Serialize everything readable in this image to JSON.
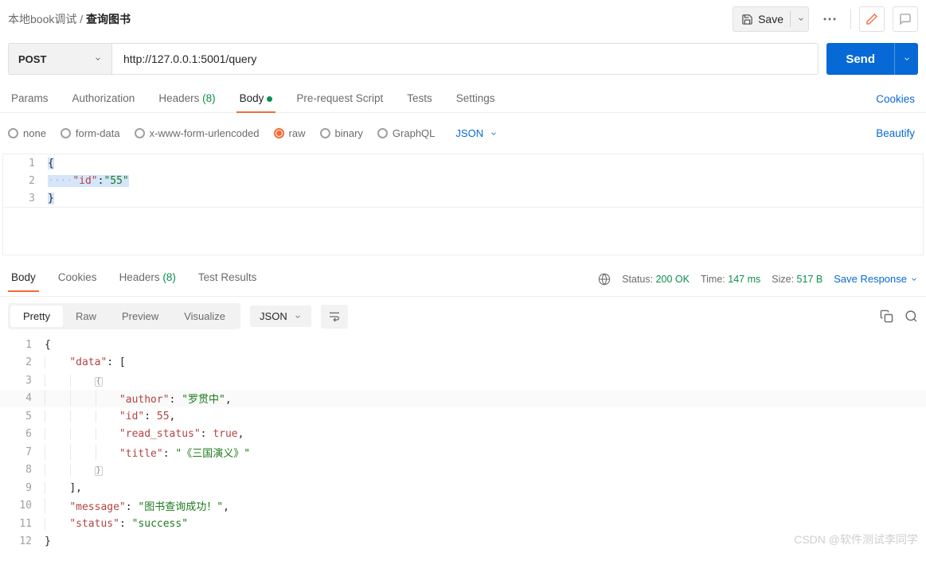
{
  "breadcrumb": {
    "folder": "本地book调试",
    "current": "查询图书"
  },
  "save_label": "Save",
  "request": {
    "method": "POST",
    "url": "http://127.0.0.1:5001/query",
    "tabs": {
      "params": "Params",
      "auth": "Authorization",
      "headers": "Headers",
      "headers_count": "(8)",
      "body": "Body",
      "prereq": "Pre-request Script",
      "tests": "Tests",
      "settings": "Settings"
    },
    "cookies_link": "Cookies",
    "body_types": {
      "none": "none",
      "formdata": "form-data",
      "urlenc": "x-www-form-urlencoded",
      "raw": "raw",
      "binary": "binary",
      "graphql": "GraphQL"
    },
    "raw_format": "JSON",
    "beautify": "Beautify",
    "body_lines": {
      "l1": "{",
      "l2_spaces": "····",
      "l2_key": "\"id\"",
      "l2_colon": ":",
      "l2_val": "\"55\"",
      "l3": "}"
    }
  },
  "send_label": "Send",
  "response": {
    "tabs": {
      "body": "Body",
      "cookies": "Cookies",
      "headers": "Headers",
      "headers_count": "(8)",
      "tests": "Test Results"
    },
    "status_label": "Status:",
    "status_val": "200 OK",
    "time_label": "Time:",
    "time_val": "147 ms",
    "size_label": "Size:",
    "size_val": "517 B",
    "save_link": "Save Response",
    "viewmodes": {
      "pretty": "Pretty",
      "raw": "Raw",
      "preview": "Preview",
      "visualize": "Visualize"
    },
    "format": "JSON",
    "json": {
      "l1": "{",
      "l2_k": "\"data\"",
      "l2_c": ": [",
      "l3": "{",
      "l4_k": "\"author\"",
      "l4_c": ": ",
      "l4_v": "\"罗贯中\"",
      "l4_t": ",",
      "l5_k": "\"id\"",
      "l5_c": ": ",
      "l5_v": "55",
      "l5_t": ",",
      "l6_k": "\"read_status\"",
      "l6_c": ": ",
      "l6_v": "true",
      "l6_t": ",",
      "l7_k": "\"title\"",
      "l7_c": ": ",
      "l7_v": "\"《三国演义》\"",
      "l8": "}",
      "l9": "],",
      "l10_k": "\"message\"",
      "l10_c": ": ",
      "l10_v": "\"图书查询成功！\"",
      "l10_t": ",",
      "l11_k": "\"status\"",
      "l11_c": ": ",
      "l11_v": "\"success\"",
      "l12": "}"
    }
  },
  "watermark": "CSDN @软件测试李同学"
}
